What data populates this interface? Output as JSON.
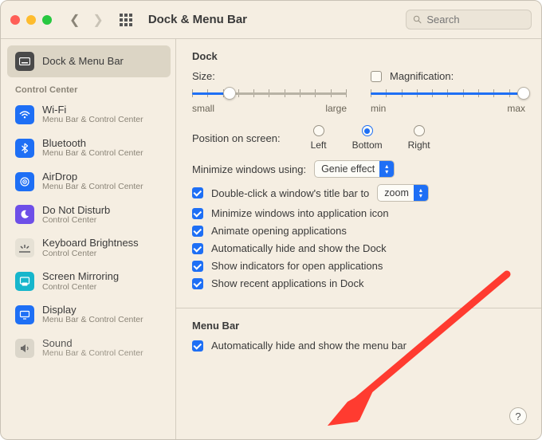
{
  "titlebar": {
    "title": "Dock & Menu Bar",
    "search_placeholder": "Search"
  },
  "sidebar": {
    "selected_label": "Dock & Menu Bar",
    "control_center_header": "Control Center",
    "items": [
      {
        "label": "Wi-Fi",
        "sub": "Menu Bar & Control Center"
      },
      {
        "label": "Bluetooth",
        "sub": "Menu Bar & Control Center"
      },
      {
        "label": "AirDrop",
        "sub": "Menu Bar & Control Center"
      },
      {
        "label": "Do Not Disturb",
        "sub": "Control Center"
      },
      {
        "label": "Keyboard Brightness",
        "sub": "Control Center"
      },
      {
        "label": "Screen Mirroring",
        "sub": "Control Center"
      },
      {
        "label": "Display",
        "sub": "Menu Bar & Control Center"
      },
      {
        "label": "Sound",
        "sub": "Menu Bar & Control Center"
      }
    ]
  },
  "dock": {
    "heading": "Dock",
    "size_label": "Size:",
    "size_small": "small",
    "size_large": "large",
    "mag_label": "Magnification:",
    "mag_checked": false,
    "mag_min": "min",
    "mag_max": "max",
    "position_label": "Position on screen:",
    "position_options": [
      "Left",
      "Bottom",
      "Right"
    ],
    "position_selected": "Bottom",
    "minimize_label": "Minimize windows using:",
    "minimize_value": "Genie effect",
    "dbl_click_label": "Double-click a window's title bar to",
    "dbl_click_value": "zoom",
    "dbl_click_checked": true,
    "opts": [
      {
        "label": "Minimize windows into application icon",
        "checked": true
      },
      {
        "label": "Animate opening applications",
        "checked": true
      },
      {
        "label": "Automatically hide and show the Dock",
        "checked": true
      },
      {
        "label": "Show indicators for open applications",
        "checked": true
      },
      {
        "label": "Show recent applications in Dock",
        "checked": true
      }
    ]
  },
  "menubar": {
    "heading": "Menu Bar",
    "autohide_label": "Automatically hide and show the menu bar",
    "autohide_checked": true
  },
  "help_label": "?"
}
